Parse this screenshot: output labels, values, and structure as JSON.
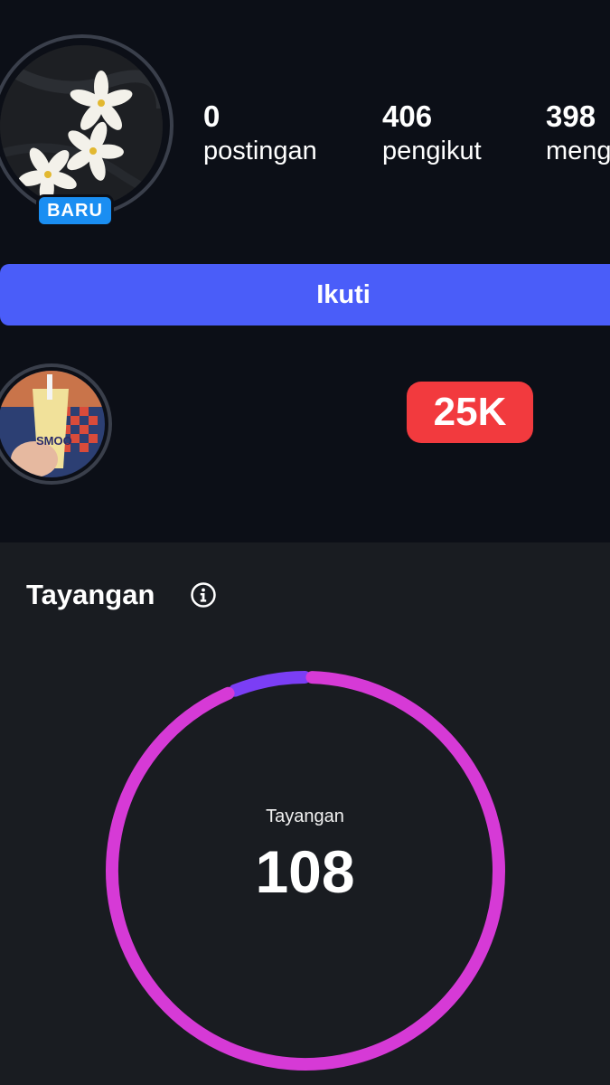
{
  "profile": {
    "new_badge": "BARU",
    "stats": [
      {
        "value": "0",
        "label": "postingan"
      },
      {
        "value": "406",
        "label": "pengikut"
      },
      {
        "value": "398",
        "label": "meng"
      }
    ],
    "follow_label": "Ikuti"
  },
  "story": {
    "thumb_text": "SMOO",
    "count_badge": "25K"
  },
  "insights": {
    "title": "Tayangan",
    "center_label": "Tayangan",
    "total": "108"
  },
  "colors": {
    "background": "#0c0f17",
    "panel": "#191c21",
    "follow_button": "#4a5df9",
    "badge_blue": "#1a8ef2",
    "badge_red": "#f23a3e",
    "ring_primary": "#d63ad6",
    "ring_secondary": "#7b3ef5"
  },
  "chart_data": {
    "type": "pie",
    "segments": [
      {
        "value": 101,
        "color": "#d63ad6"
      },
      {
        "value": 7,
        "color": "#7b3ef5"
      }
    ]
  }
}
